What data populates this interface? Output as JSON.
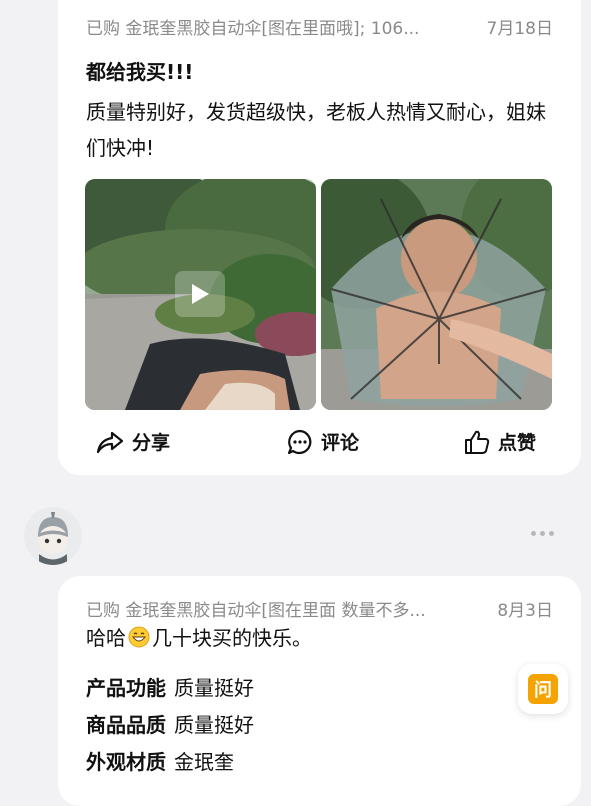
{
  "review1": {
    "purchased_label": "已购",
    "product": "金珉奎黑胶自动伞[图在里面哦]; 106...",
    "date": "7月18日",
    "title": "都给我买!!!",
    "body": "质量特别好，发货超级快，老板人热情又耐心，姐妹们快冲!"
  },
  "actions": {
    "share": "分享",
    "comment": "评论",
    "like": "点赞"
  },
  "review2": {
    "purchased_label": "已购",
    "product": "金珉奎黑胶自动伞[图在里面 数量不多...",
    "date": "8月3日",
    "text_before": "哈哈",
    "text_after": "几十块买的快乐。",
    "attributes": [
      {
        "key": "产品功能",
        "value": "质量挺好"
      },
      {
        "key": "商品品质",
        "value": "质量挺好"
      },
      {
        "key": "外观材质",
        "value": "金珉奎"
      }
    ]
  },
  "ask_button": {
    "label": "问"
  },
  "icons": [
    "play-icon",
    "share-icon",
    "comment-icon",
    "thumbs-up-icon",
    "more-icon",
    "grin-emoji-icon"
  ],
  "colors": {
    "accent": "#f5a300",
    "meta_text": "#8a8a8a",
    "background": "#f2f2f4"
  }
}
